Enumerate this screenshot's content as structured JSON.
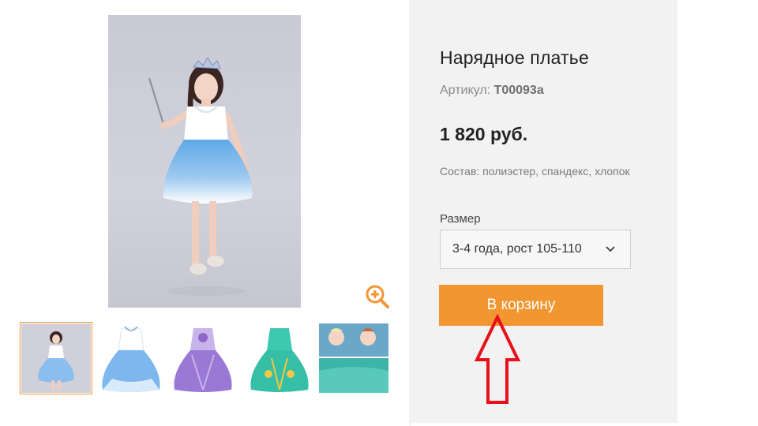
{
  "product": {
    "title": "Нарядное платье",
    "sku_label": "Артикул:",
    "sku_value": "T00093a",
    "price": "1 820 руб.",
    "composition": "Состав: полиэстер, спандекс, хлопок"
  },
  "size": {
    "label": "Размер",
    "selected": "3-4 года, рост 105-110"
  },
  "cart": {
    "button_label": "В корзину"
  },
  "gallery": {
    "thumbnails": [
      {
        "name": "girl-blue-dress",
        "active": true
      },
      {
        "name": "blue-dress"
      },
      {
        "name": "purple-dress"
      },
      {
        "name": "green-dress"
      },
      {
        "name": "frozen-dress"
      }
    ],
    "zoom_icon": "zoom-in-icon"
  },
  "colors": {
    "accent": "#f29632",
    "annotation_arrow": "#e8101a",
    "info_panel_bg": "#f2f2f2"
  }
}
